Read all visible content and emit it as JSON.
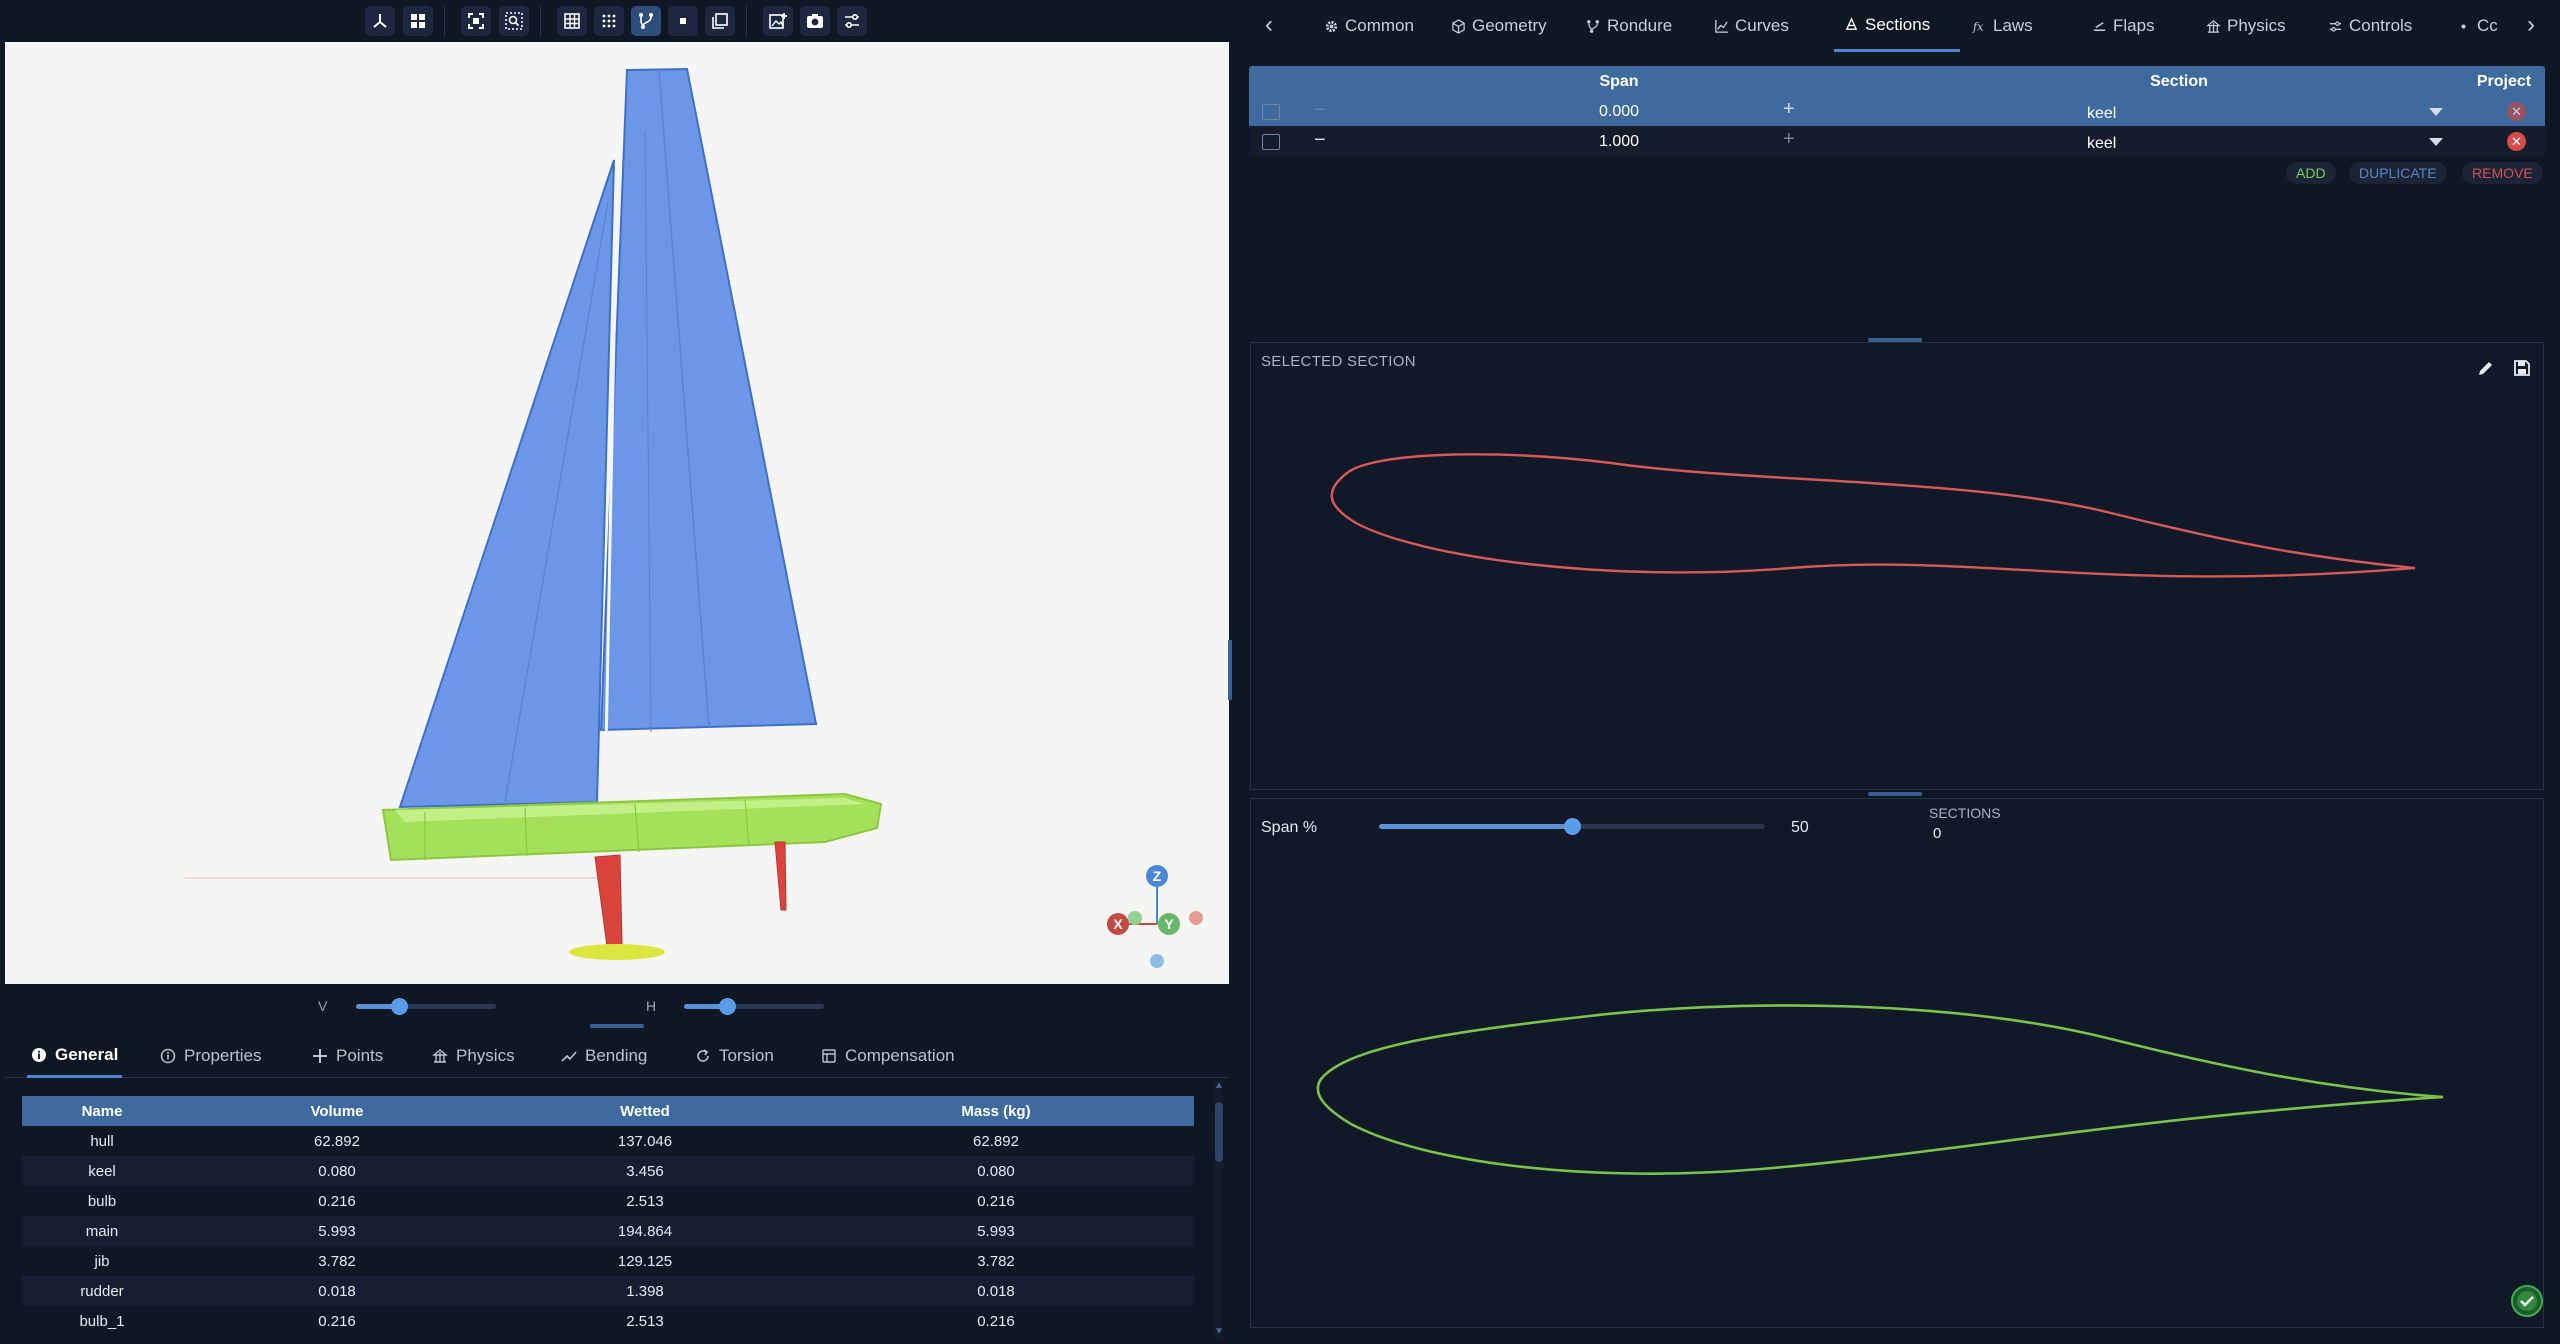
{
  "viewport": {
    "axis_labels": {
      "z": "Z",
      "x": "X",
      "y": "Y"
    },
    "sliders": {
      "v": {
        "label": "V",
        "value": 0.5
      },
      "h": {
        "label": "H",
        "value": 0.5
      }
    }
  },
  "bottom_tabs": [
    {
      "label": "General",
      "icon": "info-icon",
      "active": true
    },
    {
      "label": "Properties",
      "icon": "info-outline-icon",
      "active": false
    },
    {
      "label": "Points",
      "icon": "points-icon",
      "active": false
    },
    {
      "label": "Physics",
      "icon": "physics-icon",
      "active": false
    },
    {
      "label": "Bending",
      "icon": "trend-icon",
      "active": false
    },
    {
      "label": "Torsion",
      "icon": "rotate-icon",
      "active": false
    },
    {
      "label": "Compensation",
      "icon": "compensation-icon",
      "active": false
    }
  ],
  "table": {
    "headers": [
      "Name",
      "Volume",
      "Wetted",
      "Mass (kg)"
    ],
    "rows": [
      [
        "hull",
        "62.892",
        "137.046",
        "62.892"
      ],
      [
        "keel",
        "0.080",
        "3.456",
        "0.080"
      ],
      [
        "bulb",
        "0.216",
        "2.513",
        "0.216"
      ],
      [
        "main",
        "5.993",
        "194.864",
        "5.993"
      ],
      [
        "jib",
        "3.782",
        "129.125",
        "3.782"
      ],
      [
        "rudder",
        "0.018",
        "1.398",
        "0.018"
      ],
      [
        "bulb_1",
        "0.216",
        "2.513",
        "0.216"
      ]
    ]
  },
  "top_tabs": [
    {
      "label": "Common",
      "icon": "gear-icon",
      "active": false
    },
    {
      "label": "Geometry",
      "icon": "cube-icon",
      "active": false
    },
    {
      "label": "Rondure",
      "icon": "rondure-icon",
      "active": false
    },
    {
      "label": "Curves",
      "icon": "chart-line-icon",
      "active": false
    },
    {
      "label": "Sections",
      "icon": "sections-icon",
      "active": true
    },
    {
      "label": "Laws",
      "icon": "function-icon",
      "active": false
    },
    {
      "label": "Flaps",
      "icon": "flaps-icon",
      "active": false
    },
    {
      "label": "Physics",
      "icon": "physics-icon",
      "active": false
    },
    {
      "label": "Controls",
      "icon": "sliders-icon",
      "active": false
    },
    {
      "label": "Cc",
      "icon": "dot-icon",
      "active": false
    }
  ],
  "sections_table": {
    "headers": {
      "span": "Span",
      "section": "Section",
      "project": "Project"
    },
    "rows": [
      {
        "span": "0.000",
        "section": "keel",
        "selected": true
      },
      {
        "span": "1.000",
        "section": "keel",
        "selected": false
      }
    ],
    "actions": {
      "add": "ADD",
      "duplicate": "DUPLICATE",
      "remove": "REMOVE"
    }
  },
  "selected_section": {
    "title": "SELECTED SECTION"
  },
  "preview": {
    "span_label": "Span %",
    "span_value": "50",
    "span_fraction": 0.5,
    "sections_label": "SECTIONS",
    "sections_count": "0"
  },
  "colors": {
    "accent": "#3e6a9e",
    "selected_profile": "#d65a5a",
    "preview_profile": "#7cc24e",
    "sail": "#6b97e6",
    "hull": "#a4e05a",
    "appendage": "#d9453d"
  }
}
